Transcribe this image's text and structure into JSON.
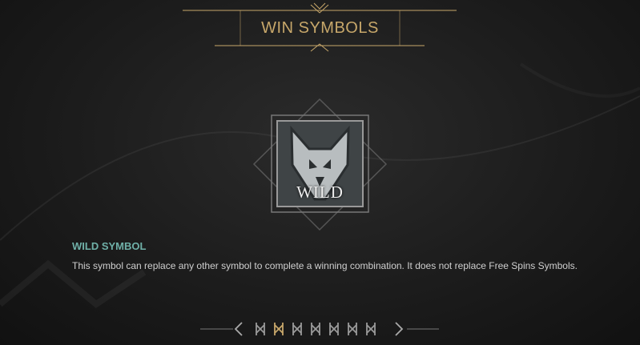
{
  "header": {
    "title": "WIN SYMBOLS"
  },
  "symbol": {
    "label": "WILD",
    "icon": "wolf-icon"
  },
  "description": {
    "title": "WILD SYMBOL",
    "text": "This symbol can replace any other symbol to complete a winning combination. It does not replace Free Spins Symbols."
  },
  "pager": {
    "prev_icon": "chevron-left-icon",
    "next_icon": "chevron-right-icon",
    "pages": 7,
    "active_page": 2
  },
  "colors": {
    "accent_gold": "#c7a76a",
    "title_teal": "#6fb0a8",
    "text_light": "#cfcfcf"
  }
}
